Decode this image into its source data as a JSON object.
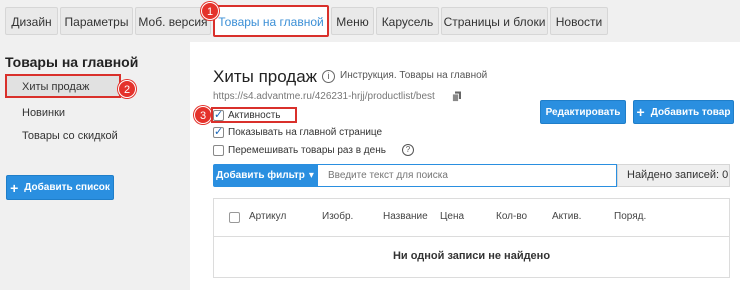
{
  "tabs": [
    {
      "label": "Дизайн"
    },
    {
      "label": "Параметры"
    },
    {
      "label": "Моб. версия"
    },
    {
      "label": "Товары на главной"
    },
    {
      "label": "Меню"
    },
    {
      "label": "Карусель"
    },
    {
      "label": "Страницы и блоки"
    },
    {
      "label": "Новости"
    }
  ],
  "sidebar": {
    "title": "Товары на главной",
    "items": [
      {
        "label": "Хиты продаж"
      },
      {
        "label": "Новинки"
      },
      {
        "label": "Товары со скидкой"
      }
    ],
    "add_button": "Добавить список"
  },
  "markers": [
    "1",
    "2",
    "3"
  ],
  "main": {
    "title": "Хиты продаж",
    "instruction": "Инструкция. Товары на главной",
    "url": "https://s4.advantme.ru/426231-hrjj/productlist/best",
    "edit_button": "Редактировать",
    "add_product_button": "Добавить товар",
    "checkboxes": [
      {
        "label": "Активность",
        "checked": true
      },
      {
        "label": "Показывать на главной странице",
        "checked": true
      },
      {
        "label": "Перемешивать товары раз в день",
        "checked": false
      }
    ]
  },
  "filter": {
    "button": "Добавить фильтр",
    "placeholder": "Введите текст для поиска",
    "found": "Найдено записей: 0"
  },
  "table": {
    "columns": [
      "Артикул",
      "Изобр.",
      "Название",
      "Цена",
      "Кол-во",
      "Актив.",
      "Поряд."
    ],
    "empty": "Ни одной записи не найдено"
  },
  "colors": {
    "accent": "#2a8fe0",
    "highlight": "#d9302b"
  }
}
